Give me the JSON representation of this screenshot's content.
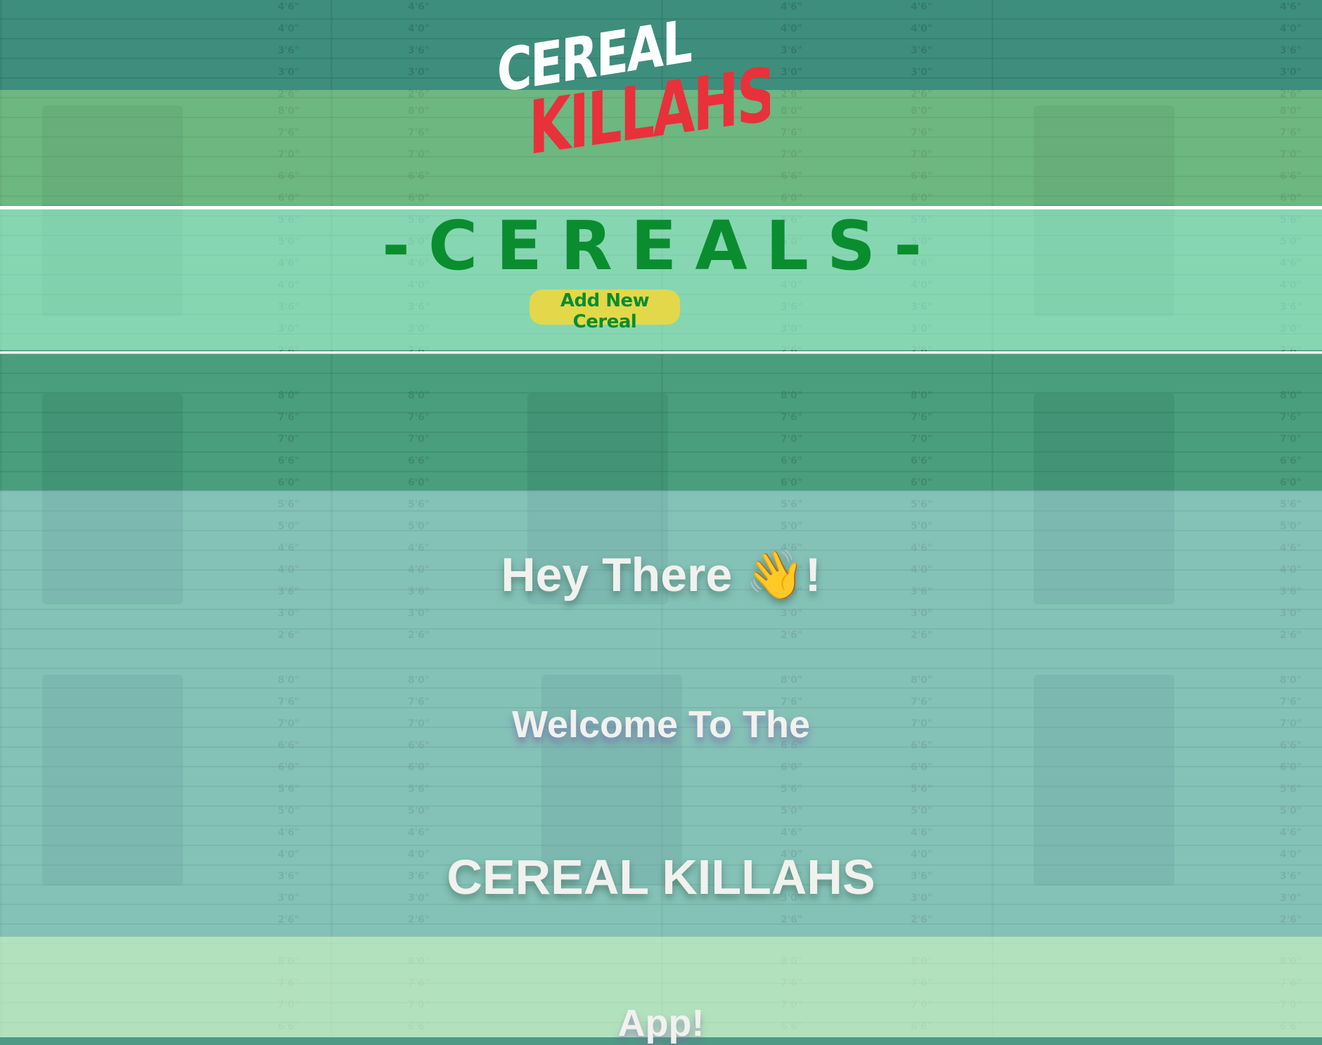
{
  "logo": {
    "line1": "CEREAL",
    "line2": "KILLAHS"
  },
  "cereals": {
    "title": "-CEREALS-",
    "add_button_label": "Add New Cereal"
  },
  "welcome": {
    "greeting": "Hey There 👋!",
    "line2": "Welcome To The",
    "app_name": "CEREAL KILLAHS",
    "line4": "App!"
  },
  "background": {
    "height_marks": [
      "8'0\"",
      "7'6\"",
      "7'0\"",
      "6'6\"",
      "6'0\"",
      "5'6\"",
      "5'0\"",
      "4'6\"",
      "4'0\"",
      "3'6\"",
      "3'0\"",
      "2'6\""
    ]
  },
  "colors": {
    "accent_green": "#0a8d2e",
    "button_yellow": "#e3d84a",
    "logo_red": "#e8313a",
    "logo_white": "#ffffff"
  }
}
